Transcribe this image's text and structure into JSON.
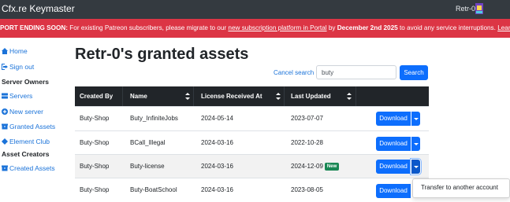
{
  "navbar": {
    "brand": "Cfx.re Keymaster",
    "user": "Retr-0"
  },
  "banner": {
    "heading": "PORT ENDING SOON:",
    "text1": " For existing Patreon subscribers, please migrate to our ",
    "link1": "new subscription platform in Portal",
    "text2": " by ",
    "date": "December 2nd 2025",
    "text3": " to avoid any service interruptions. ",
    "link2": "Learn more."
  },
  "sidebar": {
    "home": "Home",
    "signout": "Sign out",
    "server_owners": "Server Owners",
    "servers": "Servers",
    "new_server": "New server",
    "granted_assets": "Granted Assets",
    "element_club": "Element Club",
    "asset_creators": "Asset Creators",
    "created_assets": "Created Assets"
  },
  "main": {
    "title": "Retr-0's granted assets",
    "cancel_search": "Cancel search",
    "search_value": "buty",
    "search_button": "Search"
  },
  "table": {
    "headers": [
      "Created By",
      "Name",
      "License Received At",
      "Last Updated"
    ],
    "rows": [
      {
        "created_by": "Buty-Shop",
        "name": "Buty_InfiniteJobs",
        "received": "2024-05-14",
        "updated": "2023-07-07",
        "badge": ""
      },
      {
        "created_by": "Buty-Shop",
        "name": "BCall_Illegal",
        "received": "2024-03-16",
        "updated": "2022-10-28",
        "badge": ""
      },
      {
        "created_by": "Buty-Shop",
        "name": "Buty-license",
        "received": "2024-03-16",
        "updated": "2024-12-09",
        "badge": "New"
      },
      {
        "created_by": "Buty-Shop",
        "name": "Buty-BoatSchool",
        "received": "2024-03-16",
        "updated": "2023-08-05",
        "badge": ""
      }
    ],
    "download_label": "Download"
  },
  "dropdown": {
    "item": "Transfer to another account"
  }
}
